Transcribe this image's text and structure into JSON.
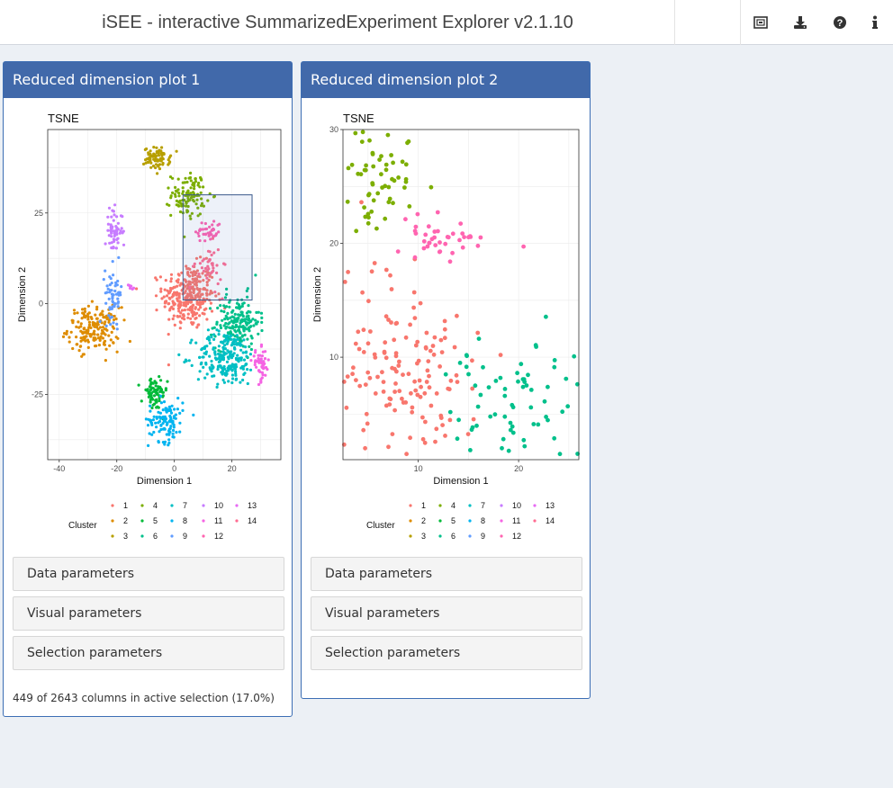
{
  "app": {
    "title": "iSEE - interactive SummarizedExperiment Explorer v2.1.10"
  },
  "toolbar": {
    "buttons": [
      {
        "name": "screenshot-icon"
      },
      {
        "name": "download-icon"
      },
      {
        "name": "help-icon"
      },
      {
        "name": "info-icon"
      }
    ]
  },
  "panels": [
    {
      "title": "Reduced dimension plot 1",
      "collapsibles": [
        "Data parameters",
        "Visual parameters",
        "Selection parameters"
      ],
      "status": "449 of 2643 columns in active selection (17.0%)"
    },
    {
      "title": "Reduced dimension plot 2",
      "collapsibles": [
        "Data parameters",
        "Visual parameters",
        "Selection parameters"
      ]
    }
  ],
  "legend": {
    "title": "Cluster",
    "colors": [
      "#F8766D",
      "#DE8C00",
      "#B79F00",
      "#7CAE00",
      "#00BA38",
      "#00C08B",
      "#00BFC4",
      "#00B4F0",
      "#619CFF",
      "#C77CFF",
      "#F564E3",
      "#FF64B0",
      "#E76BF3",
      "#FF6C91"
    ],
    "labels": [
      "1",
      "2",
      "3",
      "4",
      "5",
      "6",
      "7",
      "8",
      "9",
      "10",
      "11",
      "12",
      "13",
      "14"
    ]
  },
  "chart_data": [
    {
      "type": "scatter",
      "title": "TSNE",
      "xlabel": "Dimension 1",
      "ylabel": "Dimension 2",
      "xlim": [
        -44,
        37
      ],
      "ylim": [
        -43,
        48
      ],
      "xticks": [
        -40,
        -20,
        0,
        20
      ],
      "yticks": [
        -25,
        0,
        25
      ],
      "grid": true,
      "legend_position": "bottom",
      "selection_box": {
        "x": [
          3,
          27
        ],
        "y": [
          1,
          30
        ]
      },
      "clusters": [
        {
          "cluster": "1",
          "cx": 5,
          "cy": 2,
          "sx": 6,
          "sy": 6,
          "n": 300
        },
        {
          "cluster": "2",
          "cx": -28,
          "cy": -7,
          "sx": 6,
          "sy": 4,
          "n": 180
        },
        {
          "cluster": "3",
          "cx": -6,
          "cy": 40,
          "sx": 3,
          "sy": 2,
          "n": 80
        },
        {
          "cluster": "4",
          "cx": 5,
          "cy": 30,
          "sx": 4,
          "sy": 4,
          "n": 110
        },
        {
          "cluster": "5",
          "cx": -7,
          "cy": -25,
          "sx": 3,
          "sy": 3,
          "n": 70
        },
        {
          "cluster": "6",
          "cx": 22,
          "cy": -5,
          "sx": 5,
          "sy": 5,
          "n": 180
        },
        {
          "cluster": "7",
          "cx": 18,
          "cy": -15,
          "sx": 7,
          "sy": 5,
          "n": 220
        },
        {
          "cluster": "8",
          "cx": -3,
          "cy": -32,
          "sx": 4,
          "sy": 4,
          "n": 110
        },
        {
          "cluster": "9",
          "cx": -21,
          "cy": 3,
          "sx": 2,
          "sy": 5,
          "n": 60
        },
        {
          "cluster": "10",
          "cx": -21,
          "cy": 20,
          "sx": 2,
          "sy": 4,
          "n": 60
        },
        {
          "cluster": "11",
          "cx": 30,
          "cy": -17,
          "sx": 2,
          "sy": 3,
          "n": 50
        },
        {
          "cluster": "12",
          "cx": 12,
          "cy": 20,
          "sx": 3,
          "sy": 2,
          "n": 40
        },
        {
          "cluster": "13",
          "cx": -15,
          "cy": 5,
          "sx": 1,
          "sy": 1,
          "n": 6
        },
        {
          "cluster": "14",
          "cx": 12,
          "cy": 10,
          "sx": 3,
          "sy": 4,
          "n": 40
        }
      ]
    },
    {
      "type": "scatter",
      "title": "TSNE",
      "xlabel": "Dimension 1",
      "ylabel": "Dimension 2",
      "xlim": [
        2.5,
        26
      ],
      "ylim": [
        1,
        30
      ],
      "xticks": [
        10,
        20
      ],
      "yticks": [
        10,
        20,
        30
      ],
      "grid": true,
      "legend_position": "bottom",
      "clusters": [
        {
          "cluster": "1",
          "cx": 8,
          "cy": 9,
          "sx": 5,
          "sy": 6,
          "n": 150
        },
        {
          "cluster": "4",
          "cx": 6,
          "cy": 26,
          "sx": 3,
          "sy": 3,
          "n": 60
        },
        {
          "cluster": "6",
          "cx": 20,
          "cy": 6,
          "sx": 5,
          "sy": 4,
          "n": 70
        },
        {
          "cluster": "12",
          "cx": 12,
          "cy": 20.5,
          "sx": 3,
          "sy": 1.3,
          "n": 40
        }
      ]
    }
  ]
}
